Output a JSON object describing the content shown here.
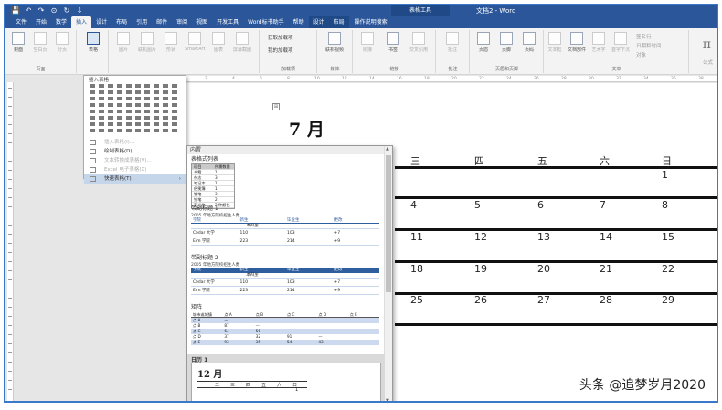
{
  "window": {
    "quick_access": [
      "💾",
      "↶",
      "↷",
      "⊙",
      "↻",
      "⇩"
    ],
    "context_title": "表格工具",
    "doc_title": "文档2 - Word"
  },
  "tabs": [
    "文件",
    "开始",
    "数学",
    "插入",
    "设计",
    "布局",
    "引用",
    "邮件",
    "审阅",
    "视图",
    "开发工具",
    "Word标书助手",
    "帮助",
    "设计",
    "布局"
  ],
  "active_tab_index": 3,
  "tell_me": "操作说明搜索",
  "ribbon": {
    "pages": {
      "buttons": [
        "封面",
        "空白页",
        "分页"
      ],
      "label": "页面"
    },
    "tables": {
      "button": "表格",
      "label": "表格"
    },
    "illustrations": {
      "buttons": [
        "图片",
        "联机图片",
        "形状",
        "SmartArt",
        "图表",
        "屏幕截图"
      ],
      "label": "插图"
    },
    "addins": {
      "get": "获取加载项",
      "my": "我的加载项",
      "label": "加载项"
    },
    "media": {
      "button": "联机视频",
      "label": "媒体"
    },
    "links": {
      "buttons": [
        "链接",
        "书签",
        "交叉引用"
      ],
      "label": "链接"
    },
    "comments": {
      "button": "批注",
      "label": "批注"
    },
    "header_footer": {
      "buttons": [
        "页眉",
        "页脚",
        "页码"
      ],
      "label": "页眉和页脚"
    },
    "text": {
      "buttons": [
        "文本框",
        "文档部件",
        "艺术字",
        "首字下沉"
      ],
      "extras": [
        "签名行",
        "日期和时间",
        "对象"
      ],
      "label": "文本"
    },
    "symbols": {
      "button": "公式"
    }
  },
  "ruler_ticks": [
    "2",
    "4",
    "6",
    "8",
    "10",
    "12",
    "14",
    "16",
    "18",
    "20",
    "22",
    "24",
    "26",
    "28",
    "30",
    "32",
    "34",
    "36",
    "38"
  ],
  "insert_table_menu": {
    "title": "插入表格",
    "grid_cols": 10,
    "grid_rows": 8,
    "items": [
      {
        "label": "插入表格(I)...",
        "disabled": true
      },
      {
        "label": "绘制表格(D)",
        "disabled": false
      },
      {
        "label": "文本转换成表格(V)...",
        "disabled": true
      },
      {
        "label": "Excel 电子表格(X)",
        "disabled": true
      },
      {
        "label": "快速表格(T)",
        "disabled": false,
        "hover": true,
        "submenu": "›"
      }
    ]
  },
  "quick_tables": {
    "header": "内置",
    "scroll_up": "▲",
    "scroll_down": "▼",
    "items": [
      {
        "label": "表格式列表",
        "header": [
          "项目",
          "所需数量"
        ],
        "rows": [
          [
            "书籍",
            "1"
          ],
          [
            "杂志",
            "3"
          ],
          [
            "笔记本",
            "1"
          ],
          [
            "便笺簿",
            "1"
          ],
          [
            "钢笔",
            "3"
          ],
          [
            "铅笔",
            "2"
          ],
          [
            "荧光笔",
            "2 种颜色"
          ]
        ]
      },
      {
        "label": "带副标题 1",
        "caption": "2005 年地方院校招生人数",
        "header": [
          "学院",
          "新生",
          "毕业生",
          "更改"
        ],
        "subhead": "本科生",
        "rows": [
          [
            "Cedar 大学",
            "110",
            "103",
            "+7"
          ],
          [
            "Elm 学院",
            "223",
            "214",
            "+9"
          ]
        ]
      },
      {
        "label": "带副标题 2",
        "caption": "2005 年地方院校招生人数",
        "header": [
          "学院",
          "新生",
          "毕业生",
          "更改"
        ],
        "subhead": "本科生",
        "rows": [
          [
            "Cedar 大学",
            "110",
            "103",
            "+7"
          ],
          [
            "Elm 学院",
            "223",
            "214",
            "+9"
          ]
        ]
      },
      {
        "label": "矩阵",
        "header": [
          "城市或城镇",
          "点 A",
          "点 B",
          "点 C",
          "点 D",
          "点 E"
        ],
        "rows": [
          [
            "点 A",
            "—",
            "",
            "",
            "",
            ""
          ],
          [
            "点 B",
            "87",
            "—",
            "",
            "",
            ""
          ],
          [
            "点 C",
            "64",
            "56",
            "—",
            "",
            ""
          ],
          [
            "点 D",
            "37",
            "32",
            "91",
            "—",
            ""
          ],
          [
            "点 E",
            "93",
            "35",
            "54",
            "43",
            "—"
          ]
        ]
      }
    ],
    "calendar_item": {
      "label": "日历 1",
      "month": "12 月",
      "weekdays": [
        "一",
        "二",
        "三",
        "四",
        "五",
        "六",
        "日"
      ],
      "first_day": "1"
    }
  },
  "document": {
    "anchor": "⊞",
    "month_title": "7 月",
    "weekdays": [
      "三",
      "四",
      "五",
      "六",
      "日"
    ],
    "weeks": [
      [
        "",
        "",
        "",
        "",
        "1"
      ],
      [
        "4",
        "5",
        "6",
        "7",
        "8"
      ],
      [
        "11",
        "12",
        "13",
        "14",
        "15"
      ],
      [
        "18",
        "19",
        "20",
        "21",
        "22"
      ],
      [
        "25",
        "26",
        "27",
        "28",
        "29"
      ]
    ]
  },
  "watermark": "头条 @追梦岁月2020"
}
